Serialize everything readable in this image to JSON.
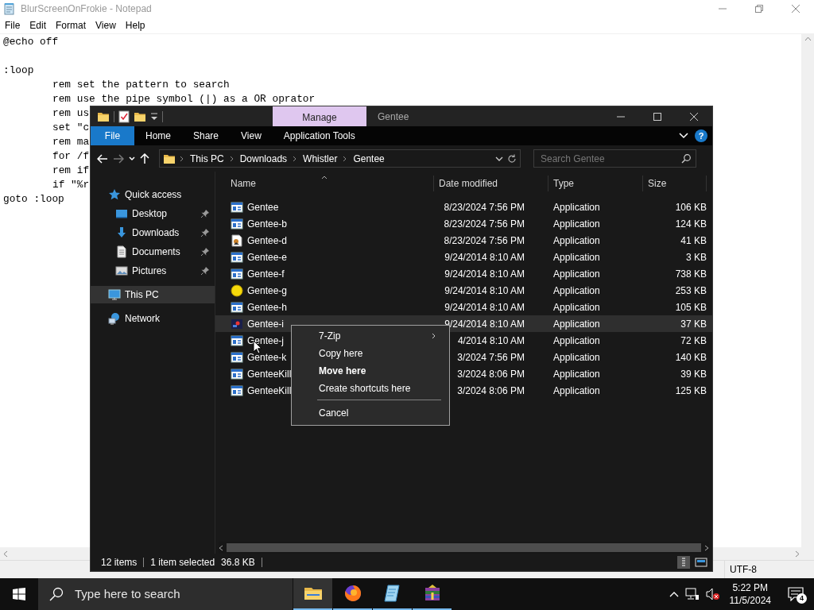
{
  "notepad": {
    "title": "BlurScreenOnFrokie - Notepad",
    "menu": [
      "File",
      "Edit",
      "Format",
      "View",
      "Help"
    ],
    "blocks": [
      {
        "lines": [
          {
            "text": "@echo off",
            "indent": false
          }
        ]
      },
      {
        "lines": [
          {
            "text": ":loop",
            "indent": false
          },
          {
            "text": "rem set the pattern to search",
            "indent": true
          },
          {
            "text": "rem use the pipe symbol (|) as a OR oprator",
            "indent": true
          },
          {
            "text": "rem us",
            "indent": true
          },
          {
            "text": "set \"c",
            "indent": true
          },
          {
            "text": "rem ma",
            "indent": true
          },
          {
            "text": "for /f",
            "indent": true
          },
          {
            "text": "rem if",
            "indent": true
          },
          {
            "text": "if \"%r",
            "indent": true
          },
          {
            "text": "goto :loop",
            "indent": false
          }
        ]
      }
    ],
    "status_bar": [
      "UTF-8"
    ]
  },
  "explorer": {
    "contextual_tab": "Manage",
    "title": "Gentee",
    "ribbon_tabs": [
      {
        "label": "File",
        "kind": "menu"
      },
      {
        "label": "Home",
        "kind": "tab"
      },
      {
        "label": "Share",
        "kind": "tab"
      },
      {
        "label": "View",
        "kind": "tab"
      },
      {
        "label": "Application Tools",
        "kind": "tab"
      }
    ],
    "help": "?",
    "nav": {
      "back_enabled": true,
      "forward_enabled": false
    },
    "breadcrumb": [
      "This PC",
      "Downloads",
      "Whistler",
      "Gentee"
    ],
    "search": {
      "placeholder": "Search Gentee"
    },
    "sidebar": [
      {
        "label": "Quick access",
        "kind": "star",
        "selected": false,
        "children": [
          {
            "label": "Desktop",
            "kind": "desktop",
            "pinned": true,
            "selected": false
          },
          {
            "label": "Downloads",
            "kind": "download",
            "pinned": true,
            "selected": false
          },
          {
            "label": "Documents",
            "kind": "document",
            "pinned": true,
            "selected": false
          },
          {
            "label": "Pictures",
            "kind": "pictures",
            "pinned": true,
            "selected": false
          }
        ]
      },
      {
        "label": "This PC",
        "kind": "pc",
        "selected": true
      },
      {
        "label": "Network",
        "kind": "network",
        "selected": false
      }
    ],
    "columns": [
      {
        "label": "Name",
        "kind": "name",
        "sorted": true
      },
      {
        "label": "Date modified",
        "kind": "date",
        "sorted": false
      },
      {
        "label": "Type",
        "kind": "type",
        "sorted": false
      },
      {
        "label": "Size",
        "kind": "size",
        "sorted": false
      }
    ],
    "files": [
      {
        "name": "Gentee",
        "date": "8/23/2024 7:56 PM",
        "type": "Application",
        "size": "106 KB",
        "kind": "app",
        "selected": false
      },
      {
        "name": "Gentee-b",
        "date": "8/23/2024 7:56 PM",
        "type": "Application",
        "size": "124 KB",
        "kind": "app",
        "selected": false
      },
      {
        "name": "Gentee-d",
        "date": "8/23/2024 7:56 PM",
        "type": "Application",
        "size": "41 KB",
        "kind": "image",
        "selected": false
      },
      {
        "name": "Gentee-e",
        "date": "9/24/2014 8:10 AM",
        "type": "Application",
        "size": "3 KB",
        "kind": "app",
        "selected": false
      },
      {
        "name": "Gentee-f",
        "date": "9/24/2014 8:10 AM",
        "type": "Application",
        "size": "738 KB",
        "kind": "app",
        "selected": false
      },
      {
        "name": "Gentee-g",
        "date": "9/24/2014 8:10 AM",
        "type": "Application",
        "size": "253 KB",
        "kind": "emoji",
        "selected": false
      },
      {
        "name": "Gentee-h",
        "date": "9/24/2014 8:10 AM",
        "type": "Application",
        "size": "105 KB",
        "kind": "app",
        "selected": false
      },
      {
        "name": "Gentee-i",
        "date": "9/24/2014 8:10 AM",
        "type": "Application",
        "size": "37 KB",
        "kind": "dark",
        "selected": true
      },
      {
        "name": "Gentee-j",
        "date": "4/2014 8:10 AM",
        "type": "Application",
        "size": "72 KB",
        "kind": "app",
        "selected": false
      },
      {
        "name": "Gentee-k",
        "date": "3/2024 7:56 PM",
        "type": "Application",
        "size": "140 KB",
        "kind": "app",
        "selected": false
      },
      {
        "name": "GenteeKill",
        "date": "3/2024 8:06 PM",
        "type": "Application",
        "size": "39 KB",
        "kind": "app",
        "selected": false
      },
      {
        "name": "GenteeKill",
        "date": "3/2024 8:06 PM",
        "type": "Application",
        "size": "125 KB",
        "kind": "app",
        "selected": false
      }
    ],
    "status_bar": {
      "count": "12 items",
      "selection": "1 item selected",
      "selection_size": "36.8 KB"
    }
  },
  "context_menu": [
    {
      "label": "7-Zip",
      "submenu": true,
      "default": false,
      "separator_before": false
    },
    {
      "label": "Copy here",
      "submenu": false,
      "default": false,
      "separator_before": false
    },
    {
      "label": "Move here",
      "submenu": false,
      "default": true,
      "separator_before": false
    },
    {
      "label": "Create shortcuts here",
      "submenu": false,
      "default": false,
      "separator_before": false
    },
    {
      "label": "Cancel",
      "submenu": false,
      "default": false,
      "separator_before": true
    }
  ],
  "taskbar": {
    "search": {
      "placeholder": "Type here to search"
    },
    "apps": [
      {
        "kind": "folder",
        "active": true
      },
      {
        "kind": "browser",
        "active": false
      },
      {
        "kind": "notepad",
        "active": false
      },
      {
        "kind": "archive",
        "active": false
      }
    ],
    "clock": {
      "time": "5:22 PM",
      "date": "11/5/2024"
    },
    "notifications": "4"
  }
}
